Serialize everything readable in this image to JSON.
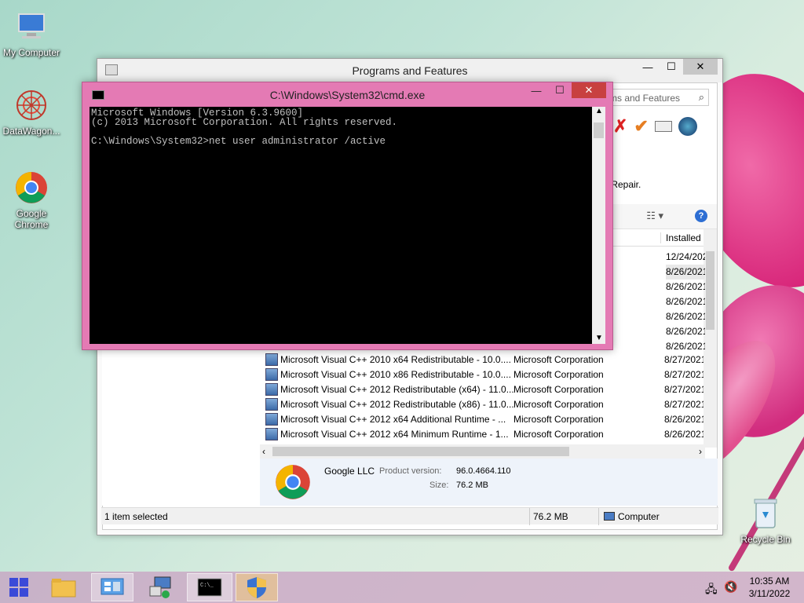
{
  "desktop": {
    "icons": [
      {
        "label": "My Computer"
      },
      {
        "label": "DataWagon..."
      },
      {
        "label": "Google Chrome"
      },
      {
        "label": "Recycle Bin"
      }
    ]
  },
  "programs_window": {
    "title": "Programs and Features",
    "search_placeholder": "ms and Features",
    "repair_text": "r Repair.",
    "column_installed": "Installed",
    "rows": [
      {
        "name": "Microsoft Visual C++ 2010  x64 Redistributable - 10.0....",
        "publisher": "Microsoft Corporation",
        "installed": "8/27/2021"
      },
      {
        "name": "Microsoft Visual C++ 2010  x86 Redistributable - 10.0....",
        "publisher": "Microsoft Corporation",
        "installed": "8/27/2021"
      },
      {
        "name": "Microsoft Visual C++ 2012 Redistributable (x64) - 11.0....",
        "publisher": "Microsoft Corporation",
        "installed": "8/27/2021"
      },
      {
        "name": "Microsoft Visual C++ 2012 Redistributable (x86) - 11.0....",
        "publisher": "Microsoft Corporation",
        "installed": "8/27/2021"
      },
      {
        "name": "Microsoft Visual C++ 2012 x64 Additional Runtime - ...",
        "publisher": "Microsoft Corporation",
        "installed": "8/26/2021"
      },
      {
        "name": "Microsoft Visual C++ 2012 x64 Minimum Runtime - 1...",
        "publisher": "Microsoft Corporation",
        "installed": "8/26/2021"
      }
    ],
    "hidden_dates": [
      "12/24/202",
      "8/26/2021",
      "8/26/2021",
      "8/26/2021",
      "8/26/2021",
      "8/26/2021",
      "8/26/2021"
    ],
    "details": {
      "publisher": "Google LLC",
      "version_label": "Product version:",
      "version": "96.0.4664.110",
      "size_label": "Size:",
      "size": "76.2 MB"
    },
    "status": {
      "selected": "1 item selected",
      "size": "76.2 MB",
      "location": "Computer"
    }
  },
  "cmd_window": {
    "title": "C:\\Windows\\System32\\cmd.exe",
    "lines": [
      "Microsoft Windows [Version 6.3.9600]",
      "(c) 2013 Microsoft Corporation. All rights reserved.",
      "",
      "C:\\Windows\\System32>net user administrator /active"
    ]
  },
  "taskbar": {
    "time": "10:35 AM",
    "date": "3/11/2022"
  }
}
